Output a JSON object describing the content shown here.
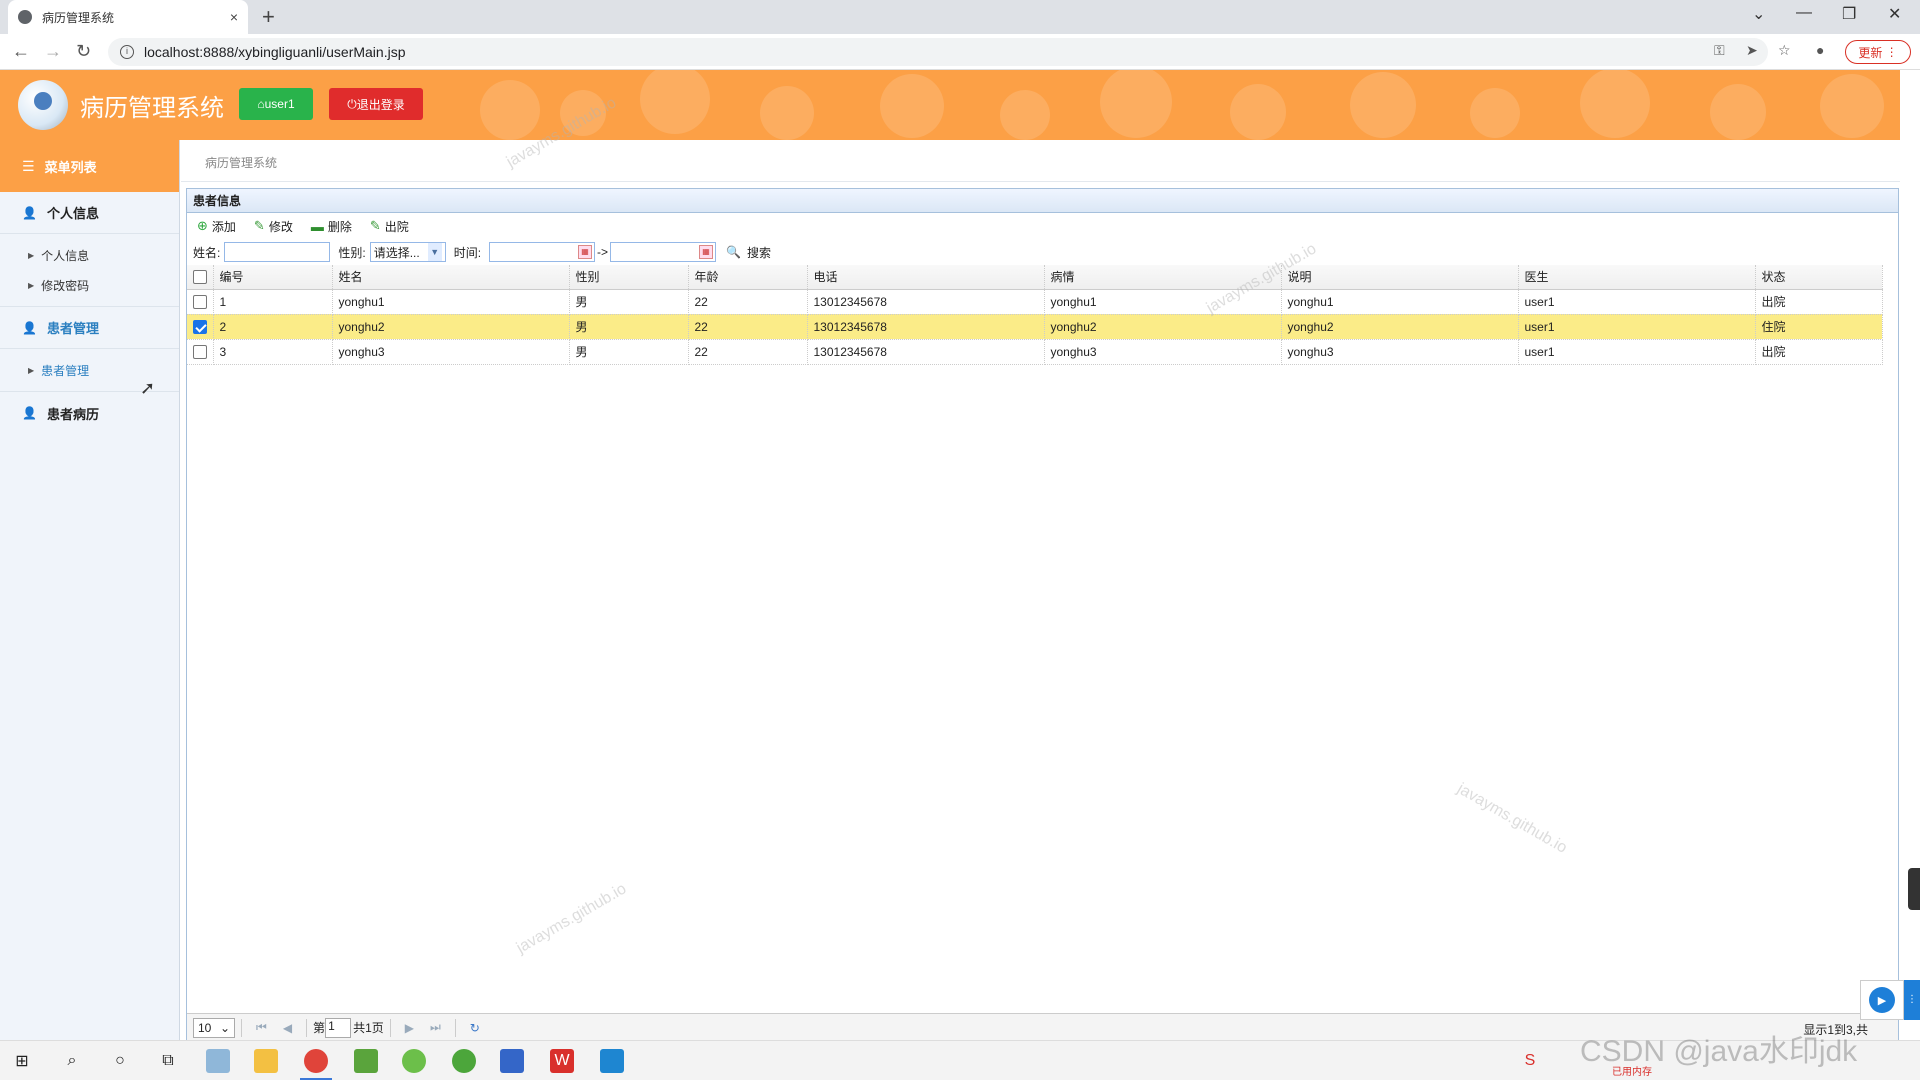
{
  "browser": {
    "tab_title": "病历管理系统",
    "tab_close": "×",
    "new_tab": "+",
    "url": "localhost:8888/xybingliguanli/userMain.jsp",
    "update_label": "更新",
    "back": "←",
    "forward": "→",
    "reload": "↻",
    "icons": [
      "key-icon",
      "send-icon",
      "star-icon",
      "profile-icon",
      "menu-icon"
    ]
  },
  "header": {
    "title": "病历管理系统",
    "user_button": "user1",
    "logout_button": "退出登录"
  },
  "sidebar": {
    "menu_title": "菜单列表",
    "groups": [
      {
        "label": "个人信息",
        "items": [
          "个人信息",
          "修改密码"
        ]
      },
      {
        "label": "患者管理",
        "items": [
          "患者管理"
        ],
        "active": true
      },
      {
        "label": "患者病历",
        "items": []
      }
    ]
  },
  "breadcrumb": "病历管理系统",
  "panel": {
    "title": "患者信息",
    "toolbar": {
      "add": "添加",
      "edit": "修改",
      "delete": "删除",
      "discharge": "出院"
    },
    "search": {
      "name_label": "姓名:",
      "gender_label": "性别:",
      "gender_selected": "请选择...",
      "time_label": "时间:",
      "range_sep": "->",
      "search_button": "搜索"
    },
    "columns": [
      "编号",
      "姓名",
      "性别",
      "年龄",
      "电话",
      "病情",
      "说明",
      "医生",
      "状态"
    ],
    "rows": [
      {
        "id": "1",
        "name": "yonghu1",
        "gender": "男",
        "age": "22",
        "phone": "13012345678",
        "condition": "yonghu1",
        "note": "yonghu1",
        "doctor": "user1",
        "status": "出院",
        "checked": false
      },
      {
        "id": "2",
        "name": "yonghu2",
        "gender": "男",
        "age": "22",
        "phone": "13012345678",
        "condition": "yonghu2",
        "note": "yonghu2",
        "doctor": "user1",
        "status": "住院",
        "checked": true
      },
      {
        "id": "3",
        "name": "yonghu3",
        "gender": "男",
        "age": "22",
        "phone": "13012345678",
        "condition": "yonghu3",
        "note": "yonghu3",
        "doctor": "user1",
        "status": "出院",
        "checked": false
      }
    ],
    "pager": {
      "page_size": "10",
      "page_prefix": "第",
      "page_value": "1",
      "page_total": "共1页",
      "info": "显示1到3,共"
    }
  },
  "watermark": "javayms.github.io",
  "taskbar": {
    "tray_mem": "已用内存",
    "csdn_mark": "CSDN @java水印jdk"
  },
  "colors": {
    "header_orange": "#fca046",
    "user_green": "#29b34b",
    "logout_red": "#e02c2c",
    "selected_row": "#fbec88",
    "active_blue": "#2b7fc0"
  }
}
